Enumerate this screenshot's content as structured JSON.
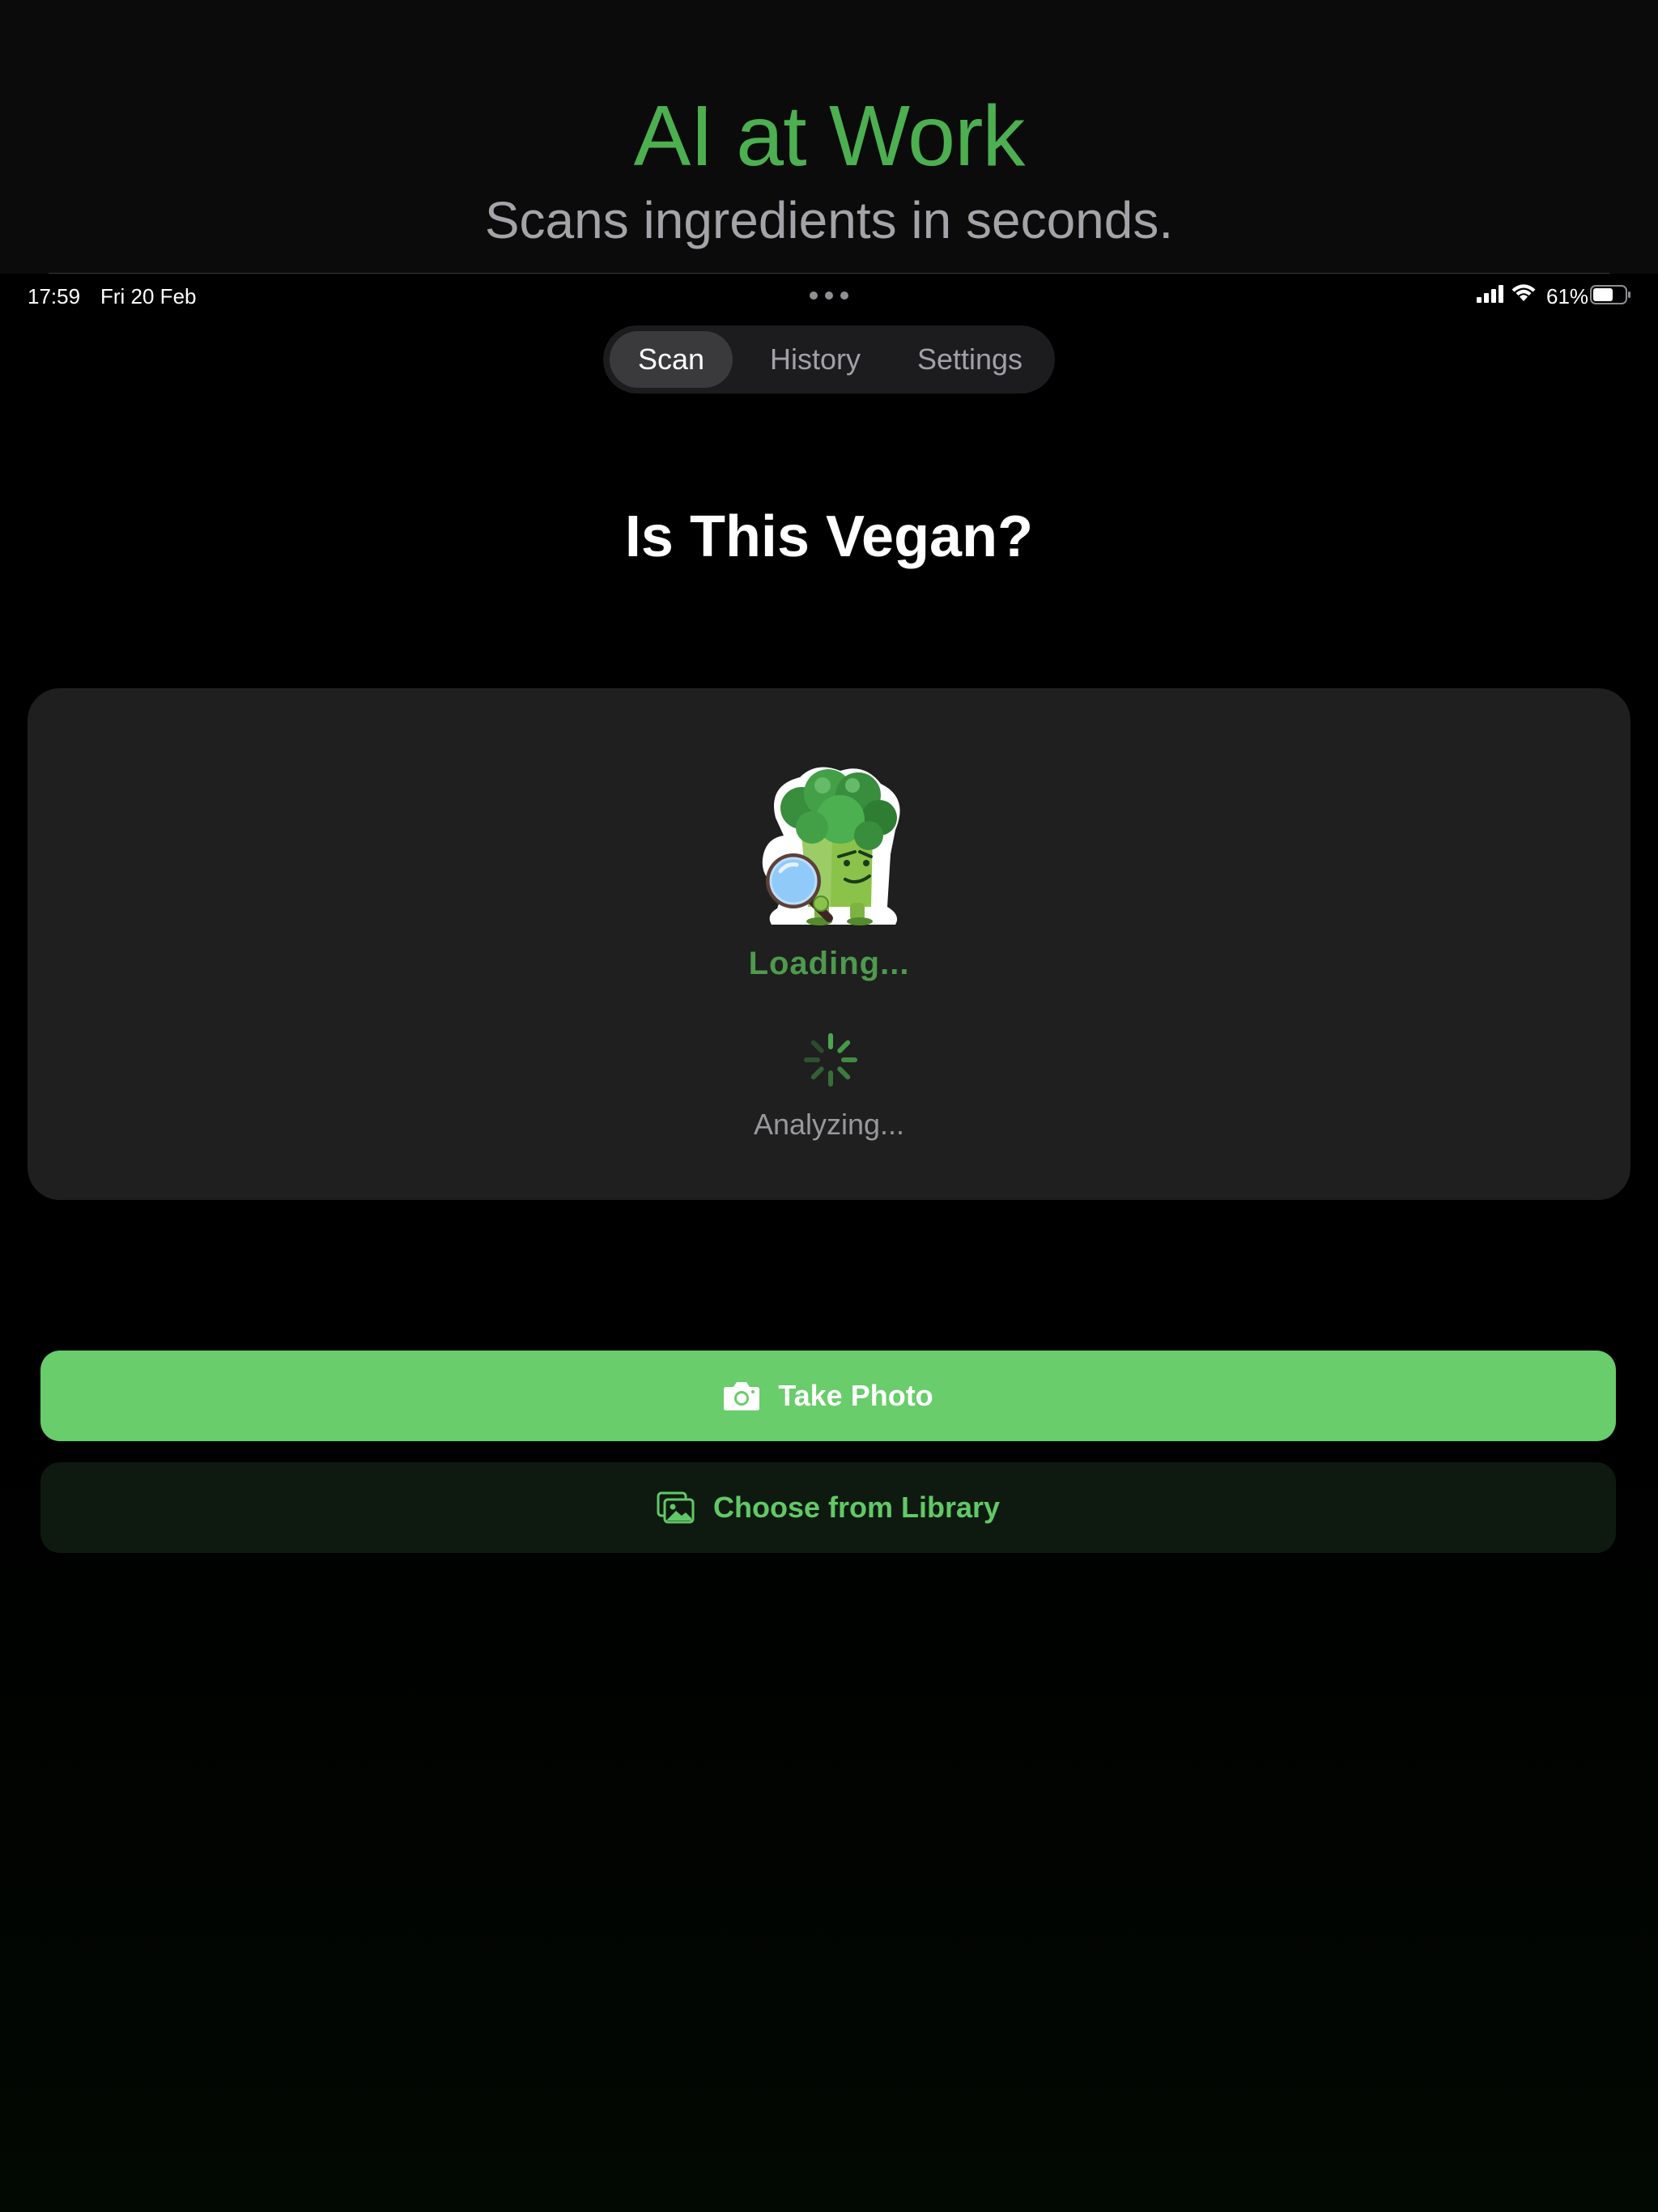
{
  "promo": {
    "title": "AI at Work",
    "subtitle": "Scans ingredients in seconds."
  },
  "status_bar": {
    "time": "17:59",
    "date": "Fri 20 Feb",
    "battery": "61%"
  },
  "tabs": [
    {
      "label": "Scan",
      "active": true
    },
    {
      "label": "History",
      "active": false
    },
    {
      "label": "Settings",
      "active": false
    }
  ],
  "screen": {
    "title": "Is This Vegan?"
  },
  "scan_card": {
    "loading_label": "Loading...",
    "status": "Analyzing..."
  },
  "actions": {
    "take_photo": "Take Photo",
    "choose_library": "Choose from Library"
  },
  "colors": {
    "accent_green": "#68cd6a",
    "promo_green": "#4caf50",
    "card_bg": "#1f1f1f"
  },
  "icons": {
    "camera": "camera-icon",
    "library": "photo-library-icon",
    "mascot": "broccoli-magnifier-mascot"
  }
}
